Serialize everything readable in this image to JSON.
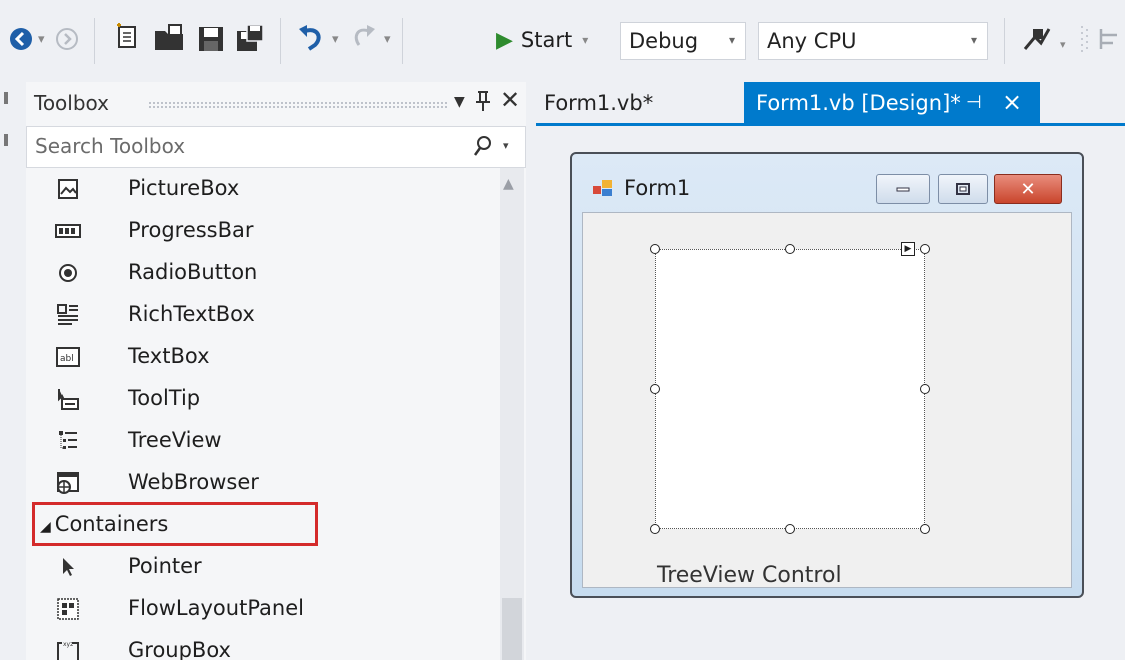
{
  "toolbar": {
    "start_label": "Start",
    "config_value": "Debug",
    "platform_value": "Any CPU"
  },
  "toolbox": {
    "title": "Toolbox",
    "search_placeholder": "Search Toolbox",
    "items": [
      {
        "label": "PictureBox",
        "icon": "picturebox-icon"
      },
      {
        "label": "ProgressBar",
        "icon": "progressbar-icon"
      },
      {
        "label": "RadioButton",
        "icon": "radiobutton-icon"
      },
      {
        "label": "RichTextBox",
        "icon": "richtextbox-icon"
      },
      {
        "label": "TextBox",
        "icon": "textbox-icon"
      },
      {
        "label": "ToolTip",
        "icon": "tooltip-icon"
      },
      {
        "label": "TreeView",
        "icon": "treeview-icon"
      },
      {
        "label": "WebBrowser",
        "icon": "webbrowser-icon"
      }
    ],
    "category": "Containers",
    "container_items": [
      {
        "label": "Pointer",
        "icon": "pointer-icon"
      },
      {
        "label": "FlowLayoutPanel",
        "icon": "flowlayoutpanel-icon"
      },
      {
        "label": "GroupBox",
        "icon": "groupbox-icon"
      }
    ]
  },
  "tabs": {
    "tab1": "Form1.vb*",
    "tab2": "Form1.vb [Design]*"
  },
  "form": {
    "title": "Form1",
    "caption": "TreeView Control"
  },
  "colors": {
    "accent": "#007acc",
    "highlight": "#d42b2b",
    "play": "#2e8b2e"
  }
}
